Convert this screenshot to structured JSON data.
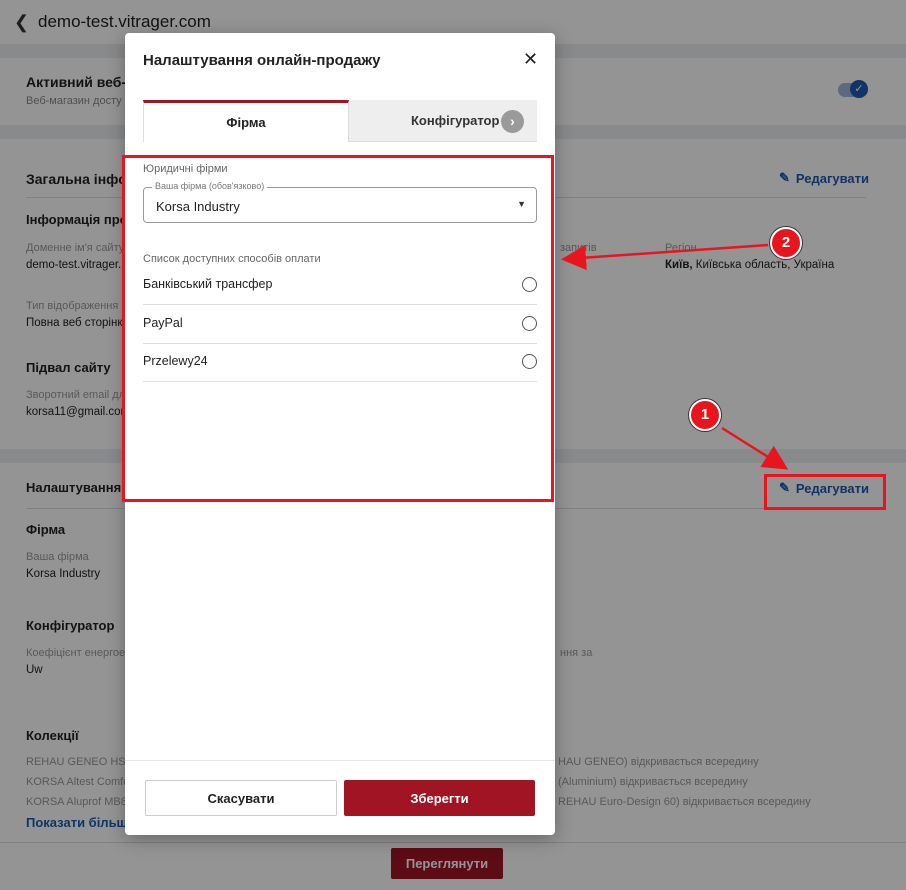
{
  "header": {
    "back_icon": "chevron-left-icon",
    "title": "demo-test.vitrager.com"
  },
  "background": {
    "active_shop": {
      "title": "Активний веб-ма",
      "subtitle": "Веб-магазин досту",
      "toggle_on": true
    },
    "general": {
      "title": "Загальна інфо",
      "edit_label": "Редагувати",
      "info_title": "Інформація про",
      "domain_label": "Доменне ім'я сайту",
      "domain_value": "demo-test.vitrager.",
      "requests_label": "запитів",
      "region_label": "Регіон",
      "region_value_bold": "Київ,",
      "region_value_rest": " Київська область, Україна",
      "display_type_label": "Тип відображення",
      "display_type_value": "Повна веб сторінк",
      "footer_title": "Підвал сайту",
      "feedback_label": "Зворотний email дл",
      "feedback_value": "korsa11@gmail.com"
    },
    "online_sales": {
      "title": "Налаштування о",
      "edit_label": "Редагувати",
      "firm_title": "Фірма",
      "firm_label": "Ваша фірма",
      "firm_value": "Korsa Industry",
      "configurator_title": "Конфігуратор",
      "coef_label": "Коефіцієнт енергое",
      "coef_value": "Uw",
      "coef_right": "ння за",
      "collections_title": "Колекції",
      "collections_left": [
        "REHAU GENEO HST в",
        "KORSA Altest Comfo",
        "KORSA Aluprof MB86"
      ],
      "collections_right": [
        "HAU GENEO) відкривається всередину",
        "(Aluminium) відкривається всередину",
        "REHAU Euro-Design 60) відкривається всередину"
      ],
      "show_more": "Показати більше"
    },
    "view_button": "Переглянути"
  },
  "modal": {
    "title": "Налаштування онлайн-продажу",
    "close_icon": "close-icon",
    "tabs": [
      {
        "label": "Фірма",
        "active": true
      },
      {
        "label": "Конфігуратор",
        "active": false
      }
    ],
    "legal_firms_label": "Юридичні фірми",
    "firm_select": {
      "legend": "Ваша фірма (обов'язково)",
      "value": "Korsa Industry"
    },
    "payment_list_label": "Список доступних способів оплати",
    "payment_methods": [
      {
        "label": "Банківський трансфер",
        "selected": false
      },
      {
        "label": "PayPal",
        "selected": false
      },
      {
        "label": "Przelewy24",
        "selected": false
      }
    ],
    "cancel_label": "Скасувати",
    "save_label": "Зберегти"
  },
  "annotations": {
    "marker_1": "1",
    "marker_2": "2"
  },
  "colors": {
    "accent": "#a01423",
    "link": "#1e5ab4",
    "annotation": "#e8141e"
  }
}
